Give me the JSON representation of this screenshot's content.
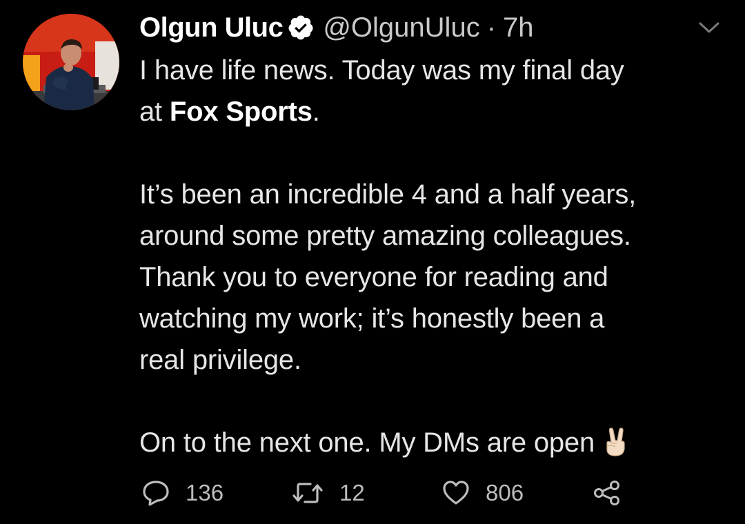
{
  "author": {
    "name": "Olgun Uluc",
    "handle": "@OlgunUluc",
    "separator": "·",
    "time": "7h",
    "verified": true
  },
  "tweet": {
    "line1": "I have life news. Today was my final day",
    "line2_prefix": "at ",
    "line2_bold": "Fox Sports",
    "line2_suffix": ".",
    "para2_lines": [
      "It’s been an incredible 4 and a half years,",
      "around some pretty amazing colleagues.",
      "Thank you to everyone for reading and",
      "watching my work; it’s honestly been a",
      "real privilege."
    ],
    "para3": "On to the next one. My DMs are open",
    "emoji": "victory-hand-emoji"
  },
  "actions": {
    "reply_count": "136",
    "retweet_count": "12",
    "like_count": "806"
  },
  "colors": {
    "background": "#000000",
    "text": "#e6e6e6",
    "secondary": "#c9c9c9",
    "verified_badge": "#ffffff"
  }
}
